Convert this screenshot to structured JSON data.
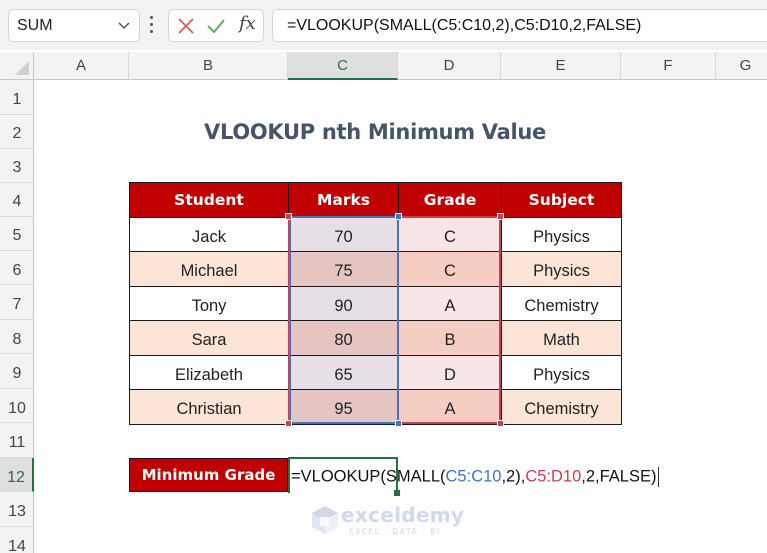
{
  "formula_bar": {
    "name_box": "SUM",
    "cancel_icon": "x-icon",
    "enter_icon": "check-icon",
    "function_icon": "fx",
    "formula": "=VLOOKUP(SMALL(C5:C10,2),C5:D10,2,FALSE)"
  },
  "columns": [
    "A",
    "B",
    "C",
    "D",
    "E",
    "F",
    "G"
  ],
  "selected_column": "C",
  "rows": [
    "1",
    "2",
    "3",
    "4",
    "5",
    "6",
    "7",
    "8",
    "9",
    "10",
    "11",
    "12",
    "13",
    "14"
  ],
  "selected_row": "12",
  "sheet": {
    "title": "VLOOKUP nth Minimum Value",
    "table": {
      "headers": [
        "Student",
        "Marks",
        "Grade",
        "Subject"
      ],
      "rows": [
        [
          "Jack",
          "70",
          "C",
          "Physics"
        ],
        [
          "Michael",
          "75",
          "C",
          "Physics"
        ],
        [
          "Tony",
          "90",
          "A",
          "Chemistry"
        ],
        [
          "Sara",
          "80",
          "B",
          "Math"
        ],
        [
          "Elizabeth",
          "65",
          "D",
          "Physics"
        ],
        [
          "Christian",
          "95",
          "A",
          "Chemistry"
        ]
      ]
    },
    "result_label": "Minimum Grade",
    "edit_formula": {
      "p1": "=VLOOKUP(SMALL(",
      "range1": "C5:C10",
      "p2": ",2)",
      "sep": ",",
      "range2": "C5:D10",
      "p3": ",2,FALSE)"
    }
  },
  "watermark": {
    "name": "exceldemy",
    "tagline": "EXCEL · DATA · BI"
  },
  "colors": {
    "header_red": "#c00000",
    "alt_row": "#fce4d6",
    "excel_green": "#217346",
    "range_blue": "#4472c4",
    "range_red": "#cc3f4e",
    "title": "#44546a"
  }
}
